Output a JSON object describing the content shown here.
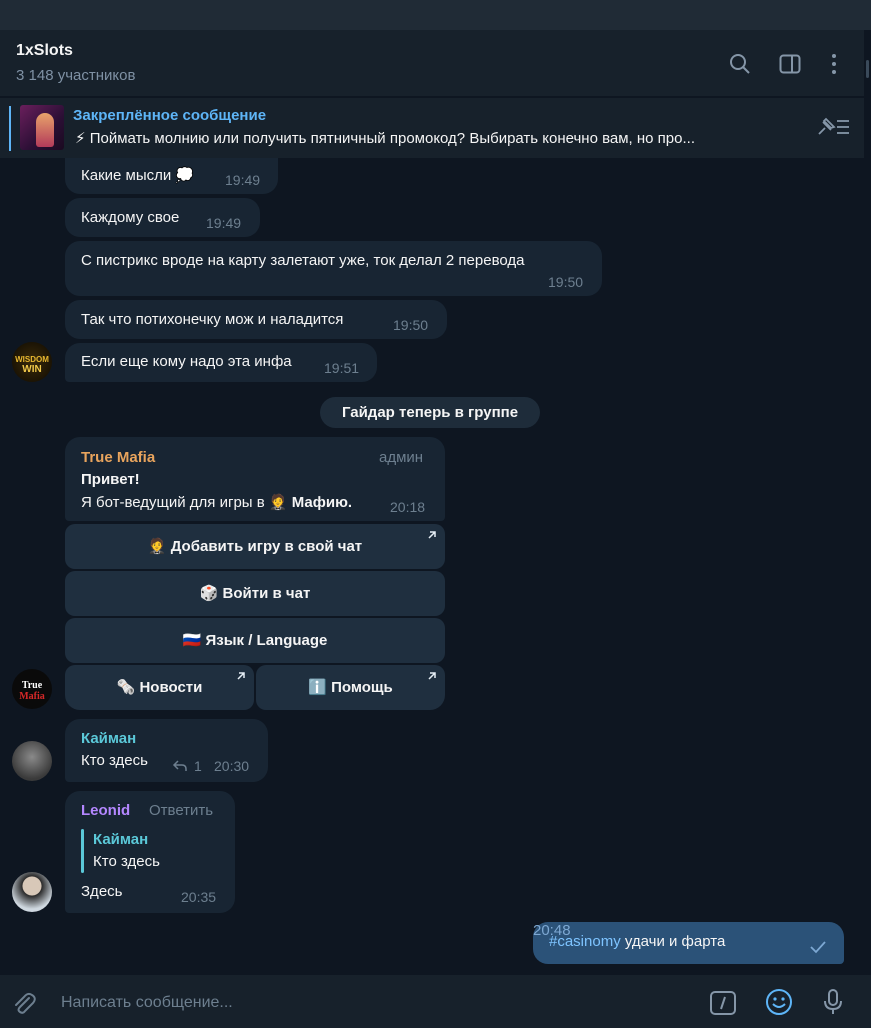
{
  "chat": {
    "title": "1xSlots",
    "subtitle": "3 148 участников"
  },
  "pinned": {
    "title": "Закреплённое сообщение",
    "text": "⚡ Поймать молнию или получить пятничный промокод? Выбирать конечно вам, но про..."
  },
  "messages": [
    {
      "text": "Какие мысли 💭",
      "time": "19:49"
    },
    {
      "text": "Каждому свое",
      "time": "19:49"
    },
    {
      "text": "С пистрикс вроде на карту залетают уже, ток делал 2 перевода",
      "time": "19:50"
    },
    {
      "text": "Так что потихонечку мож и наладится",
      "time": "19:50"
    },
    {
      "text": "Если еще кому надо эта инфа",
      "time": "19:51"
    }
  ],
  "service": "Гайдар теперь в группе",
  "bot": {
    "name": "True Mafia",
    "badge": "админ",
    "line1": "Привет!",
    "line2_prefix": "Я бот-ведущий для игры в 🤵",
    "line2_bold": "Мафию.",
    "time": "20:18",
    "buttons": {
      "add": "🤵 Добавить игру в свой чат",
      "enter": "🎲 Войти в чат",
      "lang": "🇷🇺 Язык / Language",
      "news": "🗞️ Новости",
      "help": "ℹ️ Помощь"
    }
  },
  "kayman": {
    "name": "Кайман",
    "text": "Кто здесь",
    "replies": "1",
    "time": "20:30"
  },
  "leonid": {
    "name": "Leonid",
    "reply_action": "Ответить",
    "quote_name": "Кайман",
    "quote_text": "Кто здесь",
    "text": "Здесь",
    "time": "20:35"
  },
  "outgoing": {
    "hashtag": "#casinomy",
    "text": " удачи и фарта",
    "time": "20:48"
  },
  "composer": {
    "placeholder": "Написать сообщение..."
  },
  "avatars": {
    "wisdom": "WISDOM WIN",
    "truemafia": "True Mafia"
  },
  "colors": {
    "accent": "#5eb5f7",
    "bot_name": "#e8a45d",
    "kayman_name": "#5bc8d8",
    "leonid_name": "#b487ff"
  }
}
